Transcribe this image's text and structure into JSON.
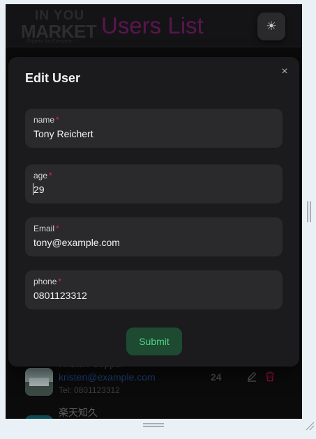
{
  "header": {
    "logo_line1": "IN YOU",
    "logo_line2": "MARKET",
    "logo_tagline": "Organic for Everyone",
    "title": "Users List",
    "theme_icon": "☀"
  },
  "background_users": [
    {
      "name": "Kristen Copper",
      "email": "kristen@example.com",
      "tel": "Tel: 0801123312",
      "age": "24"
    },
    {
      "name": "楽天知久"
    }
  ],
  "modal": {
    "title": "Edit User",
    "close_icon": "×",
    "fields": [
      {
        "label": "name",
        "value": "Tony Reichert"
      },
      {
        "label": "age",
        "value": "29"
      },
      {
        "label": "Email",
        "value": "tony@example.com"
      },
      {
        "label": "phone",
        "value": "0801123312"
      }
    ],
    "required_mark": "*",
    "submit_label": "Submit"
  },
  "colors": {
    "title": "#5c1450",
    "required": "#e0245e",
    "submit_bg": "#1e4a32",
    "submit_text": "#4fd184",
    "link": "#1d3f78",
    "delete": "#8a1235"
  }
}
